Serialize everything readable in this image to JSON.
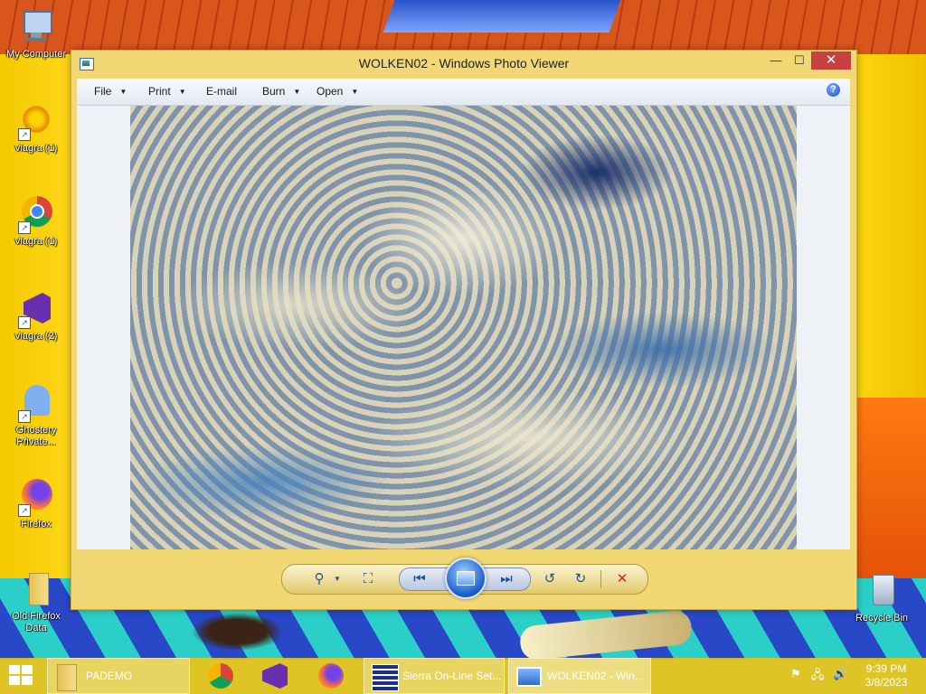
{
  "desktop": {
    "icons": [
      {
        "label": "My Computer",
        "icon": "computer-icon"
      },
      {
        "label": "viagra (1)",
        "icon": "sunburst-icon"
      },
      {
        "label": "viagra (1)",
        "icon": "chrome-icon"
      },
      {
        "label": "viagra (2)",
        "icon": "visual-studio-icon"
      },
      {
        "label": "Ghostery Private...",
        "icon": "ghostery-icon"
      },
      {
        "label": "Firefox",
        "icon": "firefox-icon"
      },
      {
        "label": "Old Firefox Data",
        "icon": "folder-icon"
      },
      {
        "label": "Recycle Bin",
        "icon": "recycle-bin-icon"
      }
    ]
  },
  "window": {
    "title": "WOLKEN02 - Windows Photo Viewer",
    "controls": {
      "minimize": "—",
      "maximize": "☐",
      "close": "✕"
    },
    "menu": [
      {
        "label": "File",
        "has_dropdown": true
      },
      {
        "label": "Print",
        "has_dropdown": true
      },
      {
        "label": "E-mail",
        "has_dropdown": false
      },
      {
        "label": "Burn",
        "has_dropdown": true
      },
      {
        "label": "Open",
        "has_dropdown": true
      }
    ],
    "help_glyph": "?",
    "toolbar": {
      "zoom": "⚲",
      "fit": "⛶",
      "previous": "⏮",
      "next": "⏭",
      "rotate_left": "↺",
      "rotate_right": "↻",
      "delete": "✕"
    }
  },
  "taskbar": {
    "items": [
      {
        "label": "PADEMO",
        "icon": "folder-icon"
      },
      {
        "label": "",
        "icon": "chrome-icon"
      },
      {
        "label": "",
        "icon": "visual-studio-icon"
      },
      {
        "label": "",
        "icon": "firefox-icon"
      },
      {
        "label": "Sierra On-Line Set...",
        "icon": "installer-icon"
      },
      {
        "label": "WOLKEN02 - Win...",
        "icon": "photo-viewer-icon"
      }
    ],
    "tray": {
      "flag": "⚑",
      "network": "🖧",
      "volume": "🔊"
    },
    "clock": {
      "time": "9:39 PM",
      "date": "3/8/2023"
    }
  },
  "colors": {
    "accent": "#f2d875",
    "close": "#c84040",
    "taskbar": "#dcc328"
  }
}
